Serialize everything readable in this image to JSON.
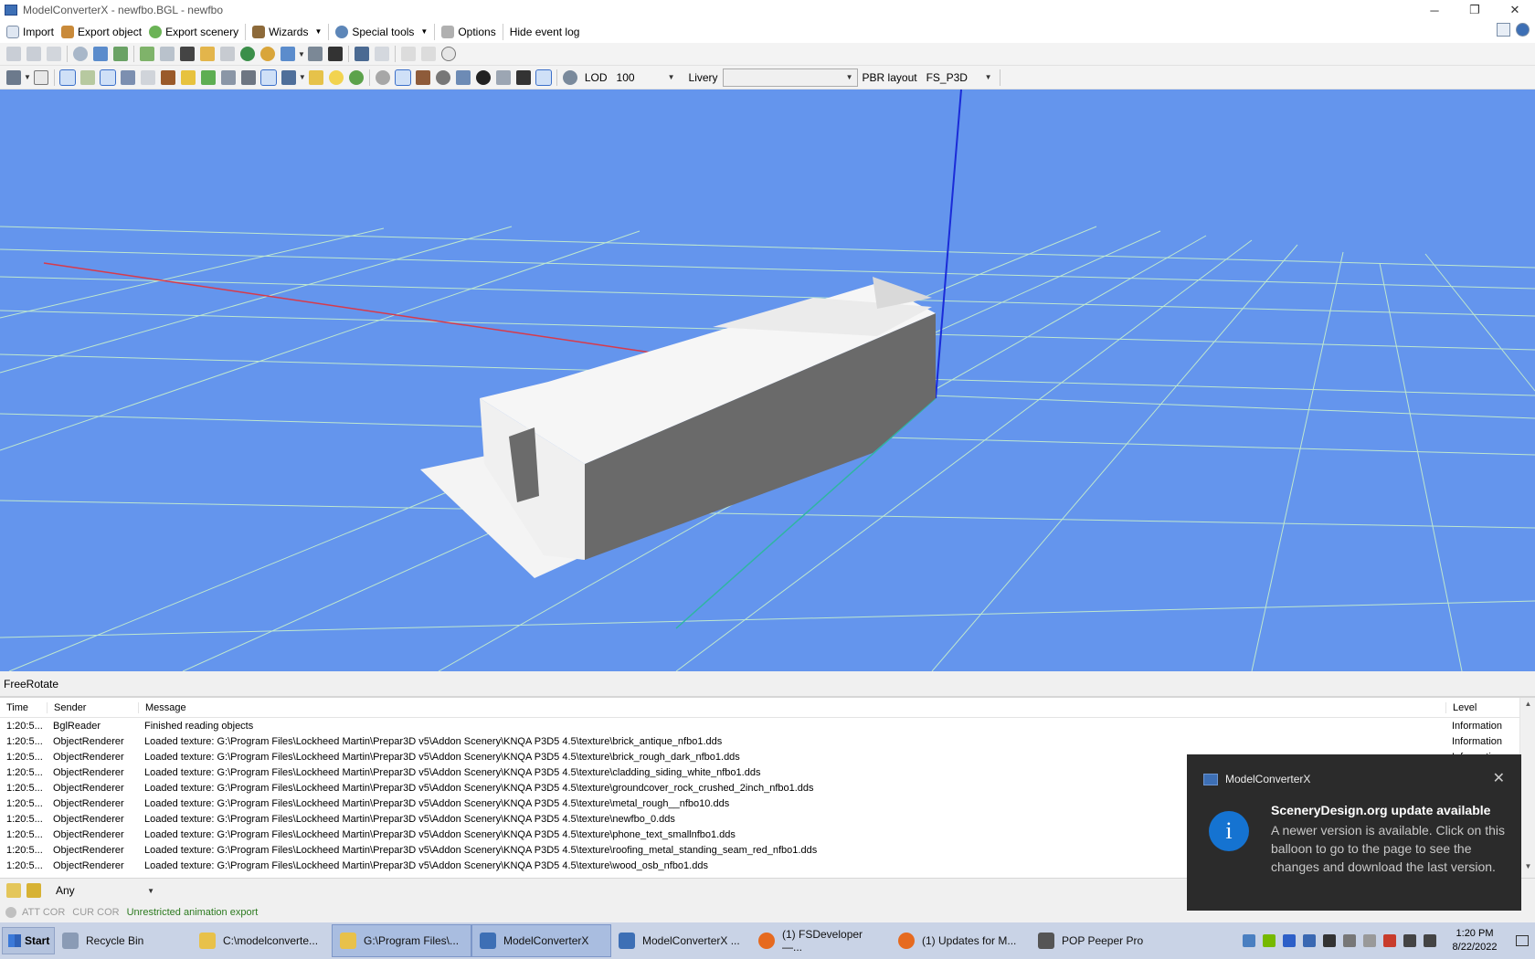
{
  "window": {
    "title": "ModelConverterX - newfbo.BGL - newfbo",
    "controls": [
      "─",
      "❐",
      "✕"
    ]
  },
  "menu": {
    "import": "Import",
    "export_object": "Export object",
    "export_scenery": "Export scenery",
    "wizards": "Wizards",
    "special_tools": "Special tools",
    "options": "Options",
    "hide_event_log": "Hide event log"
  },
  "toolbar2": {
    "lod_label": "LOD",
    "lod_value": "100",
    "livery_label": "Livery",
    "livery_value": "",
    "pbr_label": "PBR layout",
    "pbr_value": "FS_P3D"
  },
  "viewport": {
    "mode": "FreeRotate",
    "background_color": "#6495ed"
  },
  "log": {
    "columns": {
      "time": "Time",
      "sender": "Sender",
      "message": "Message",
      "level": "Level"
    },
    "rows": [
      {
        "time": "1:20:5...",
        "sender": "BglReader",
        "message": "Finished reading objects",
        "level": "Information"
      },
      {
        "time": "1:20:5...",
        "sender": "ObjectRenderer",
        "message": "Loaded texture: G:\\Program Files\\Lockheed Martin\\Prepar3D v5\\Addon Scenery\\KNQA P3D5 4.5\\texture\\brick_antique_nfbo1.dds",
        "level": "Information"
      },
      {
        "time": "1:20:5...",
        "sender": "ObjectRenderer",
        "message": "Loaded texture: G:\\Program Files\\Lockheed Martin\\Prepar3D v5\\Addon Scenery\\KNQA P3D5 4.5\\texture\\brick_rough_dark_nfbo1.dds",
        "level": "Information"
      },
      {
        "time": "1:20:5...",
        "sender": "ObjectRenderer",
        "message": "Loaded texture: G:\\Program Files\\Lockheed Martin\\Prepar3D v5\\Addon Scenery\\KNQA P3D5 4.5\\texture\\cladding_siding_white_nfbo1.dds",
        "level": ""
      },
      {
        "time": "1:20:5...",
        "sender": "ObjectRenderer",
        "message": "Loaded texture: G:\\Program Files\\Lockheed Martin\\Prepar3D v5\\Addon Scenery\\KNQA P3D5 4.5\\texture\\groundcover_rock_crushed_2inch_nfbo1.dds",
        "level": ""
      },
      {
        "time": "1:20:5...",
        "sender": "ObjectRenderer",
        "message": "Loaded texture: G:\\Program Files\\Lockheed Martin\\Prepar3D v5\\Addon Scenery\\KNQA P3D5 4.5\\texture\\metal_rough__nfbo10.dds",
        "level": ""
      },
      {
        "time": "1:20:5...",
        "sender": "ObjectRenderer",
        "message": "Loaded texture: G:\\Program Files\\Lockheed Martin\\Prepar3D v5\\Addon Scenery\\KNQA P3D5 4.5\\texture\\newfbo_0.dds",
        "level": ""
      },
      {
        "time": "1:20:5...",
        "sender": "ObjectRenderer",
        "message": "Loaded texture: G:\\Program Files\\Lockheed Martin\\Prepar3D v5\\Addon Scenery\\KNQA P3D5 4.5\\texture\\phone_text_smallnfbo1.dds",
        "level": ""
      },
      {
        "time": "1:20:5...",
        "sender": "ObjectRenderer",
        "message": "Loaded texture: G:\\Program Files\\Lockheed Martin\\Prepar3D v5\\Addon Scenery\\KNQA P3D5 4.5\\texture\\roofing_metal_standing_seam_red_nfbo1.dds",
        "level": ""
      },
      {
        "time": "1:20:5...",
        "sender": "ObjectRenderer",
        "message": "Loaded texture: G:\\Program Files\\Lockheed Martin\\Prepar3D v5\\Addon Scenery\\KNQA P3D5 4.5\\texture\\wood_osb_nfbo1.dds",
        "level": ""
      }
    ]
  },
  "filter": {
    "value": "Any"
  },
  "status": {
    "att_cor": "ATT COR",
    "cur_cor": "CUR COR",
    "message": "Unrestricted animation export"
  },
  "notification": {
    "app": "ModelConverterX",
    "title": "SceneryDesign.org update available",
    "body": "A newer version is available. Click on this balloon to go to the page to see the changes and download the last version.",
    "info_glyph": "i",
    "close_glyph": "✕"
  },
  "taskbar": {
    "start": "Start",
    "items": [
      {
        "label": "Recycle Bin",
        "icon": "recycle-bin-icon",
        "color": "#8a9bb5"
      },
      {
        "label": "C:\\modelconverte...",
        "icon": "folder-icon",
        "color": "#e8c14a"
      },
      {
        "label": "G:\\Program Files\\...",
        "icon": "folder-icon",
        "color": "#e8c14a"
      },
      {
        "label": "ModelConverterX",
        "icon": "modelconverterx-icon",
        "color": "#3d6fb5"
      },
      {
        "label": "ModelConverterX ...",
        "icon": "modelconverterx-icon",
        "color": "#3d6fb5"
      },
      {
        "label": "(1) FSDeveloper —...",
        "icon": "firefox-icon",
        "color": "#e66a1f"
      },
      {
        "label": "(1) Updates for M...",
        "icon": "firefox-icon",
        "color": "#e66a1f"
      },
      {
        "label": "POP Peeper Pro",
        "icon": "pop-peeper-icon",
        "color": "#555555"
      }
    ],
    "clock_time": "1:20 PM",
    "clock_date": "8/22/2022"
  }
}
